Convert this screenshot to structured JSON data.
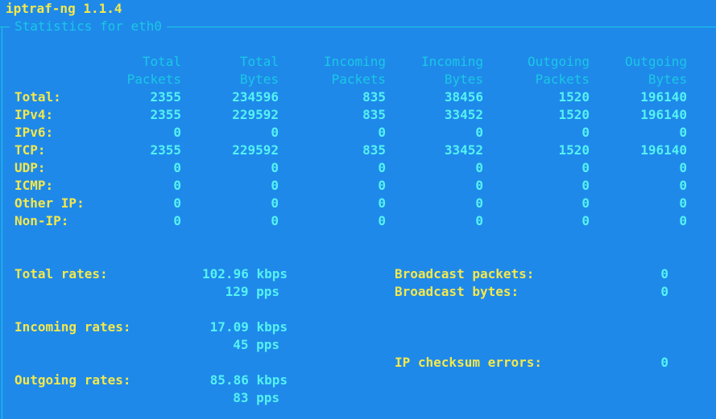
{
  "app_title": "iptraf-ng 1.1.4",
  "window_title": "Statistics for eth0",
  "table": {
    "headers": [
      [
        "Total",
        "Packets"
      ],
      [
        "Total",
        "Bytes"
      ],
      [
        "Incoming",
        "Packets"
      ],
      [
        "Incoming",
        "Bytes"
      ],
      [
        "Outgoing",
        "Packets"
      ],
      [
        "Outgoing",
        "Bytes"
      ]
    ],
    "rows": [
      {
        "label": "Total:",
        "values": [
          "2355",
          "234596",
          "835",
          "38456",
          "1520",
          "196140"
        ]
      },
      {
        "label": "IPv4:",
        "values": [
          "2355",
          "229592",
          "835",
          "33452",
          "1520",
          "196140"
        ]
      },
      {
        "label": "IPv6:",
        "values": [
          "0",
          "0",
          "0",
          "0",
          "0",
          "0"
        ]
      },
      {
        "label": "TCP:",
        "values": [
          "2355",
          "229592",
          "835",
          "33452",
          "1520",
          "196140"
        ]
      },
      {
        "label": "UDP:",
        "values": [
          "0",
          "0",
          "0",
          "0",
          "0",
          "0"
        ]
      },
      {
        "label": "ICMP:",
        "values": [
          "0",
          "0",
          "0",
          "0",
          "0",
          "0"
        ]
      },
      {
        "label": "Other IP:",
        "values": [
          "0",
          "0",
          "0",
          "0",
          "0",
          "0"
        ]
      },
      {
        "label": "Non-IP:",
        "values": [
          "0",
          "0",
          "0",
          "0",
          "0",
          "0"
        ]
      }
    ]
  },
  "rates": {
    "total": {
      "label": "Total rates:",
      "kbps": "102.96 kbps",
      "pps": "129 pps"
    },
    "incoming": {
      "label": "Incoming rates:",
      "kbps": "17.09 kbps",
      "pps": "45 pps"
    },
    "outgoing": {
      "label": "Outgoing rates:",
      "kbps": "85.86 kbps",
      "pps": "83 pps"
    }
  },
  "broadcast": {
    "packets_label": "Broadcast packets:",
    "packets_value": "0",
    "bytes_label": "Broadcast bytes:",
    "bytes_value": "0"
  },
  "checksum": {
    "label": "IP checksum errors:",
    "value": "0"
  },
  "colors": {
    "background": "#1f89ea",
    "label_yellow": "#f3e84c",
    "value_cyan": "#54f2f2",
    "header_cyan": "#19c8e3"
  }
}
